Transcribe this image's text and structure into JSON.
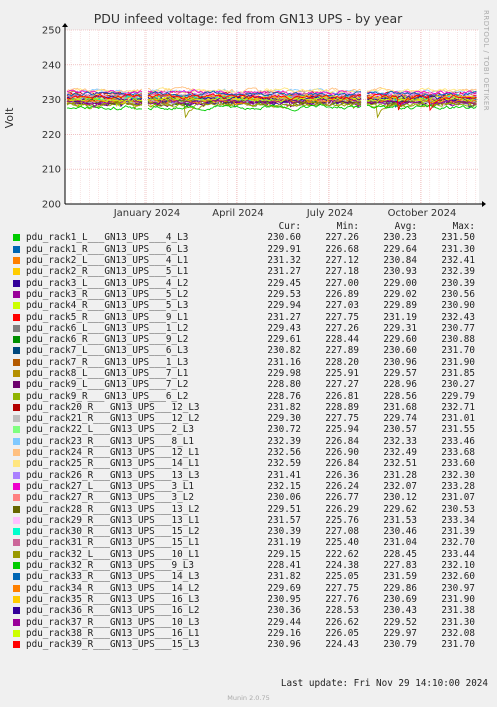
{
  "chart_data": {
    "type": "line",
    "title": "PDU infeed voltage: fed from GN13 UPS - by year",
    "ylabel": "Volt",
    "xlabel": "",
    "ylim": [
      200,
      250
    ],
    "yticks": [
      200,
      210,
      220,
      230,
      240,
      250
    ],
    "xticks": [
      "January 2024",
      "April 2024",
      "July 2024",
      "October 2024"
    ],
    "grid": true,
    "legend_columns": [
      "Cur:",
      "Min:",
      "Avg:",
      "Max:"
    ],
    "series": [
      {
        "name": "pdu_rack1_L___GN13_UPS___4_L3",
        "color": "#00cc00",
        "cur": "230.60",
        "min": "227.26",
        "avg": "230.23",
        "max": "231.50"
      },
      {
        "name": "pdu_rack1_R___GN13_UPS___6_L3",
        "color": "#0066b3",
        "cur": "229.91",
        "min": "226.68",
        "avg": "229.64",
        "max": "231.30"
      },
      {
        "name": "pdu_rack2_L___GN13_UPS___4_L1",
        "color": "#ff8000",
        "cur": "231.32",
        "min": "227.12",
        "avg": "230.84",
        "max": "232.41"
      },
      {
        "name": "pdu_rack2_R___GN13_UPS___5_L1",
        "color": "#ffcc00",
        "cur": "231.27",
        "min": "227.18",
        "avg": "230.93",
        "max": "232.39"
      },
      {
        "name": "pdu_rack3_L___GN13_UPS___4_L2",
        "color": "#330099",
        "cur": "229.45",
        "min": "227.00",
        "avg": "229.00",
        "max": "230.39"
      },
      {
        "name": "pdu_rack3_R___GN13_UPS___5_L2",
        "color": "#990099",
        "cur": "229.53",
        "min": "226.89",
        "avg": "229.02",
        "max": "230.56"
      },
      {
        "name": "pdu_rack4_R___GN13_UPS___5_L3",
        "color": "#ccff00",
        "cur": "229.94",
        "min": "227.03",
        "avg": "229.89",
        "max": "230.90"
      },
      {
        "name": "pdu_rack5_R___GN13_UPS___9_L1",
        "color": "#ff0000",
        "cur": "231.27",
        "min": "227.75",
        "avg": "231.19",
        "max": "232.43"
      },
      {
        "name": "pdu_rack6_L___GN13_UPS___1_L2",
        "color": "#808080",
        "cur": "229.43",
        "min": "227.26",
        "avg": "229.31",
        "max": "230.77"
      },
      {
        "name": "pdu_rack6_R___GN13_UPS___9_L2",
        "color": "#008f00",
        "cur": "229.61",
        "min": "228.44",
        "avg": "229.60",
        "max": "230.88"
      },
      {
        "name": "pdu_rack7_L___GN13_UPS___6_L3",
        "color": "#00487d",
        "cur": "230.82",
        "min": "227.89",
        "avg": "230.60",
        "max": "231.70"
      },
      {
        "name": "pdu_rack7_R___GN13_UPS___1_L3",
        "color": "#b35a00",
        "cur": "231.16",
        "min": "228.20",
        "avg": "230.96",
        "max": "231.90"
      },
      {
        "name": "pdu_rack8_L___GN13_UPS___7_L1",
        "color": "#b38f00",
        "cur": "229.98",
        "min": "225.91",
        "avg": "229.57",
        "max": "231.85"
      },
      {
        "name": "pdu_rack9_L___GN13_UPS___7_L2",
        "color": "#6b006b",
        "cur": "228.80",
        "min": "227.27",
        "avg": "228.96",
        "max": "230.27"
      },
      {
        "name": "pdu_rack9_R___GN13_UPS___6_L2",
        "color": "#8fb300",
        "cur": "228.76",
        "min": "226.81",
        "avg": "228.56",
        "max": "229.79"
      },
      {
        "name": "pdu_rack20_R___GN13_UPS___12_L3",
        "color": "#b30000",
        "cur": "231.82",
        "min": "228.89",
        "avg": "231.68",
        "max": "232.71"
      },
      {
        "name": "pdu_rack21_R___GN13_UPS___12_L2",
        "color": "#bebebe",
        "cur": "229.30",
        "min": "227.75",
        "avg": "229.74",
        "max": "231.01"
      },
      {
        "name": "pdu_rack22_L___GN13_UPS___2_L3",
        "color": "#80ff80",
        "cur": "230.72",
        "min": "225.94",
        "avg": "230.57",
        "max": "231.55"
      },
      {
        "name": "pdu_rack23_R___GN13_UPS___8_L1",
        "color": "#80c9ff",
        "cur": "232.39",
        "min": "226.84",
        "avg": "232.33",
        "max": "233.46"
      },
      {
        "name": "pdu_rack24_R___GN13_UPS___12_L1",
        "color": "#ffc080",
        "cur": "232.56",
        "min": "226.90",
        "avg": "232.49",
        "max": "233.68"
      },
      {
        "name": "pdu_rack25_R___GN13_UPS___14_L1",
        "color": "#ffe680",
        "cur": "232.59",
        "min": "226.84",
        "avg": "232.51",
        "max": "233.60"
      },
      {
        "name": "pdu_rack26_R___GN13_UPS___13_L3",
        "color": "#aa80ff",
        "cur": "231.41",
        "min": "226.36",
        "avg": "231.28",
        "max": "232.30"
      },
      {
        "name": "pdu_rack27_L___GN13_UPS___3_L1",
        "color": "#ee00cc",
        "cur": "232.15",
        "min": "226.24",
        "avg": "232.07",
        "max": "233.28"
      },
      {
        "name": "pdu_rack27_R___GN13_UPS___3_L2",
        "color": "#ff8080",
        "cur": "230.06",
        "min": "226.77",
        "avg": "230.12",
        "max": "231.07"
      },
      {
        "name": "pdu_rack28_R___GN13_UPS___13_L2",
        "color": "#666600",
        "cur": "229.51",
        "min": "226.29",
        "avg": "229.62",
        "max": "230.53"
      },
      {
        "name": "pdu_rack29_R___GN13_UPS___13_L1",
        "color": "#ffbfff",
        "cur": "231.57",
        "min": "225.76",
        "avg": "231.53",
        "max": "233.34"
      },
      {
        "name": "pdu_rack30_R___GN13_UPS___15_L2",
        "color": "#00ffcc",
        "cur": "230.39",
        "min": "227.08",
        "avg": "230.46",
        "max": "231.39"
      },
      {
        "name": "pdu_rack31_R___GN13_UPS___15_L1",
        "color": "#cc6699",
        "cur": "231.19",
        "min": "225.40",
        "avg": "231.04",
        "max": "232.70"
      },
      {
        "name": "pdu_rack32_L___GN13_UPS___10_L1",
        "color": "#999900",
        "cur": "229.15",
        "min": "222.62",
        "avg": "228.45",
        "max": "233.44"
      },
      {
        "name": "pdu_rack32_R___GN13_UPS___9_L3",
        "color": "#00cc00",
        "cur": "228.41",
        "min": "224.38",
        "avg": "227.83",
        "max": "232.10"
      },
      {
        "name": "pdu_rack33_R___GN13_UPS___14_L3",
        "color": "#0066b3",
        "cur": "231.82",
        "min": "225.05",
        "avg": "231.59",
        "max": "232.60"
      },
      {
        "name": "pdu_rack34_R___GN13_UPS___14_L2",
        "color": "#ff8000",
        "cur": "229.69",
        "min": "227.75",
        "avg": "229.86",
        "max": "230.97"
      },
      {
        "name": "pdu_rack35_R___GN13_UPS___16_L3",
        "color": "#ffcc00",
        "cur": "230.95",
        "min": "227.76",
        "avg": "230.69",
        "max": "231.90"
      },
      {
        "name": "pdu_rack36_R___GN13_UPS___16_L2",
        "color": "#330099",
        "cur": "230.36",
        "min": "228.53",
        "avg": "230.43",
        "max": "231.38"
      },
      {
        "name": "pdu_rack37_R___GN13_UPS___10_L3",
        "color": "#990099",
        "cur": "229.44",
        "min": "226.62",
        "avg": "229.52",
        "max": "231.30"
      },
      {
        "name": "pdu_rack38_R___GN13_UPS___16_L1",
        "color": "#ccff00",
        "cur": "229.16",
        "min": "226.05",
        "avg": "229.97",
        "max": "232.08"
      },
      {
        "name": "pdu_rack39_R___GN13_UPS___15_L3",
        "color": "#ff0000",
        "cur": "230.96",
        "min": "224.43",
        "avg": "230.79",
        "max": "231.70"
      }
    ]
  },
  "side_text": "RRDTOOL / TOBI OETIKER",
  "footer": {
    "last_update": "Last update: Fri Nov 29 14:10:00 2024",
    "version": "Munin 2.0.75"
  }
}
